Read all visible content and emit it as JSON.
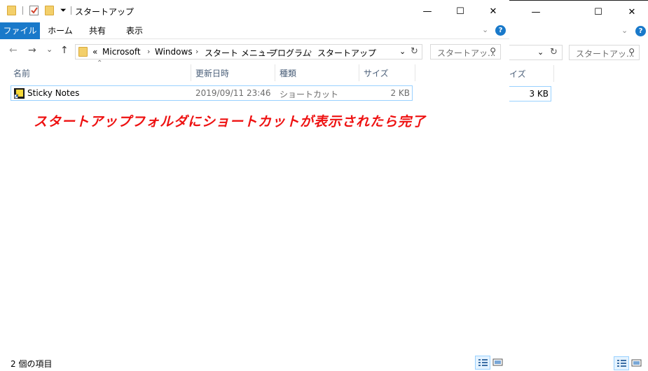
{
  "window": {
    "title": "スタートアップ",
    "minimize": "—",
    "maximize": "☐",
    "close": "✕"
  },
  "ribbon": {
    "file": "ファイル",
    "home": "ホーム",
    "share": "共有",
    "view": "表示",
    "help": "?"
  },
  "nav": {
    "back": "←",
    "forward": "→",
    "recent": "⌄",
    "up": "↑",
    "overflow": "«",
    "breadcrumbs": [
      "Microsoft",
      "Windows",
      "スタート メニュー",
      "プログラム",
      "スタートアップ"
    ],
    "search_placeholder": "スタートアッ..."
  },
  "columns": [
    "名前",
    "更新日時",
    "種類",
    "サイズ"
  ],
  "files": [
    {
      "name": "Sticky Notes",
      "modified": "2019/09/11 23:46",
      "type": "ショートカット",
      "size": "2 KB"
    }
  ],
  "back_window": {
    "search_placeholder": "スタートアッ...",
    "col_size": "イズ",
    "file_size": "3 KB"
  },
  "status": {
    "count": "2 個の項目"
  },
  "annotation": "スタートアップフォルダにショートカットが表示されたら完了"
}
